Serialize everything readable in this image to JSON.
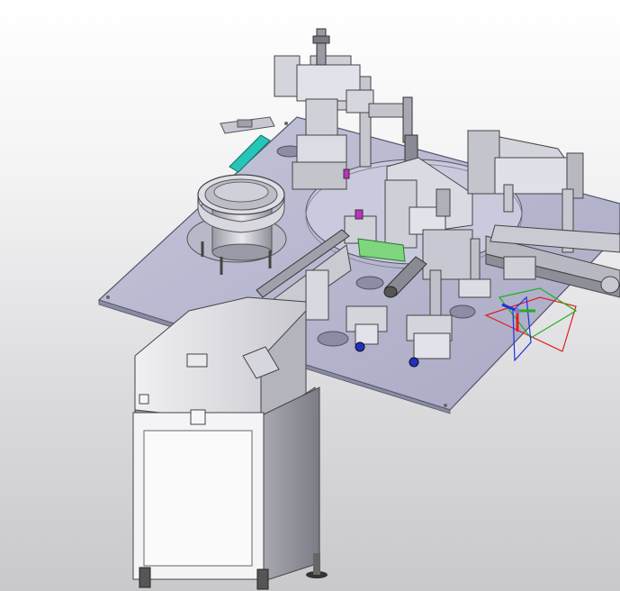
{
  "app": {
    "window_title": "",
    "view_mode": "shaded-with-edges",
    "background_gradient": [
      "#ffffff",
      "#c9c9cc"
    ]
  },
  "model": {
    "description_visible_text": "",
    "components": [
      {
        "name": "base-plate",
        "color": "#b8b8d0"
      },
      {
        "name": "rotary-index-table",
        "color": "#c8c8dc"
      },
      {
        "name": "vibratory-bowl-feeder",
        "color": "#c4c4cc"
      },
      {
        "name": "linear-feeder-track",
        "color": "#a8a8b0"
      },
      {
        "name": "feeder-cabinet",
        "color": "#e6e6ea"
      },
      {
        "name": "press-station-top",
        "color": "#d0d0d8"
      },
      {
        "name": "pneumatic-cylinder-right",
        "color": "#c0c0c8"
      },
      {
        "name": "belt-conveyor-right",
        "color": "#b0b0b8"
      },
      {
        "name": "green-fixture",
        "color": "#7fd67f"
      },
      {
        "name": "teal-chute",
        "color": "#27c4b8"
      },
      {
        "name": "valve-blocks",
        "color": "#d4d4dc"
      }
    ]
  },
  "triad": {
    "x_color": "#e02020",
    "y_color": "#20b020",
    "z_color": "#2030e0"
  }
}
